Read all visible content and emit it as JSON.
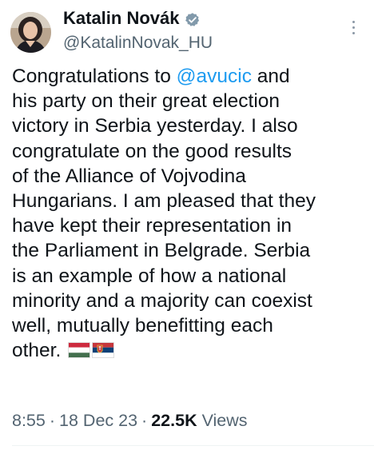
{
  "author": {
    "name": "Katalin Novák",
    "handle": "@KatalinNovak_HU",
    "verified_icon": "verified-badge-icon",
    "verified_color": "#829aab"
  },
  "tweet": {
    "lines": [
      {
        "before": "Congratulations to ",
        "mention": "@avucic",
        "after": " and"
      },
      {
        "text": "his party on their great election"
      },
      {
        "text": "victory in Serbia yesterday. I also"
      },
      {
        "text": "congratulate on the good results"
      },
      {
        "text": "of the Alliance of Vojvodina"
      },
      {
        "text": "Hungarians. I am pleased that they"
      },
      {
        "text": "have kept their representation in"
      },
      {
        "text": "the Parliament in Belgrade. Serbia"
      },
      {
        "text": "is an example of how a national"
      },
      {
        "text": "minority and a majority can coexist"
      },
      {
        "text": "well, mutually benefitting each"
      },
      {
        "text": "other. "
      }
    ],
    "emojis": [
      "hungary-flag-icon",
      "serbia-flag-icon"
    ],
    "mention_color": "#1d9bf0"
  },
  "meta": {
    "time": "8:55",
    "separator": "·",
    "date": "18 Dec 23",
    "views_count": "22.5K",
    "views_label": " Views"
  }
}
